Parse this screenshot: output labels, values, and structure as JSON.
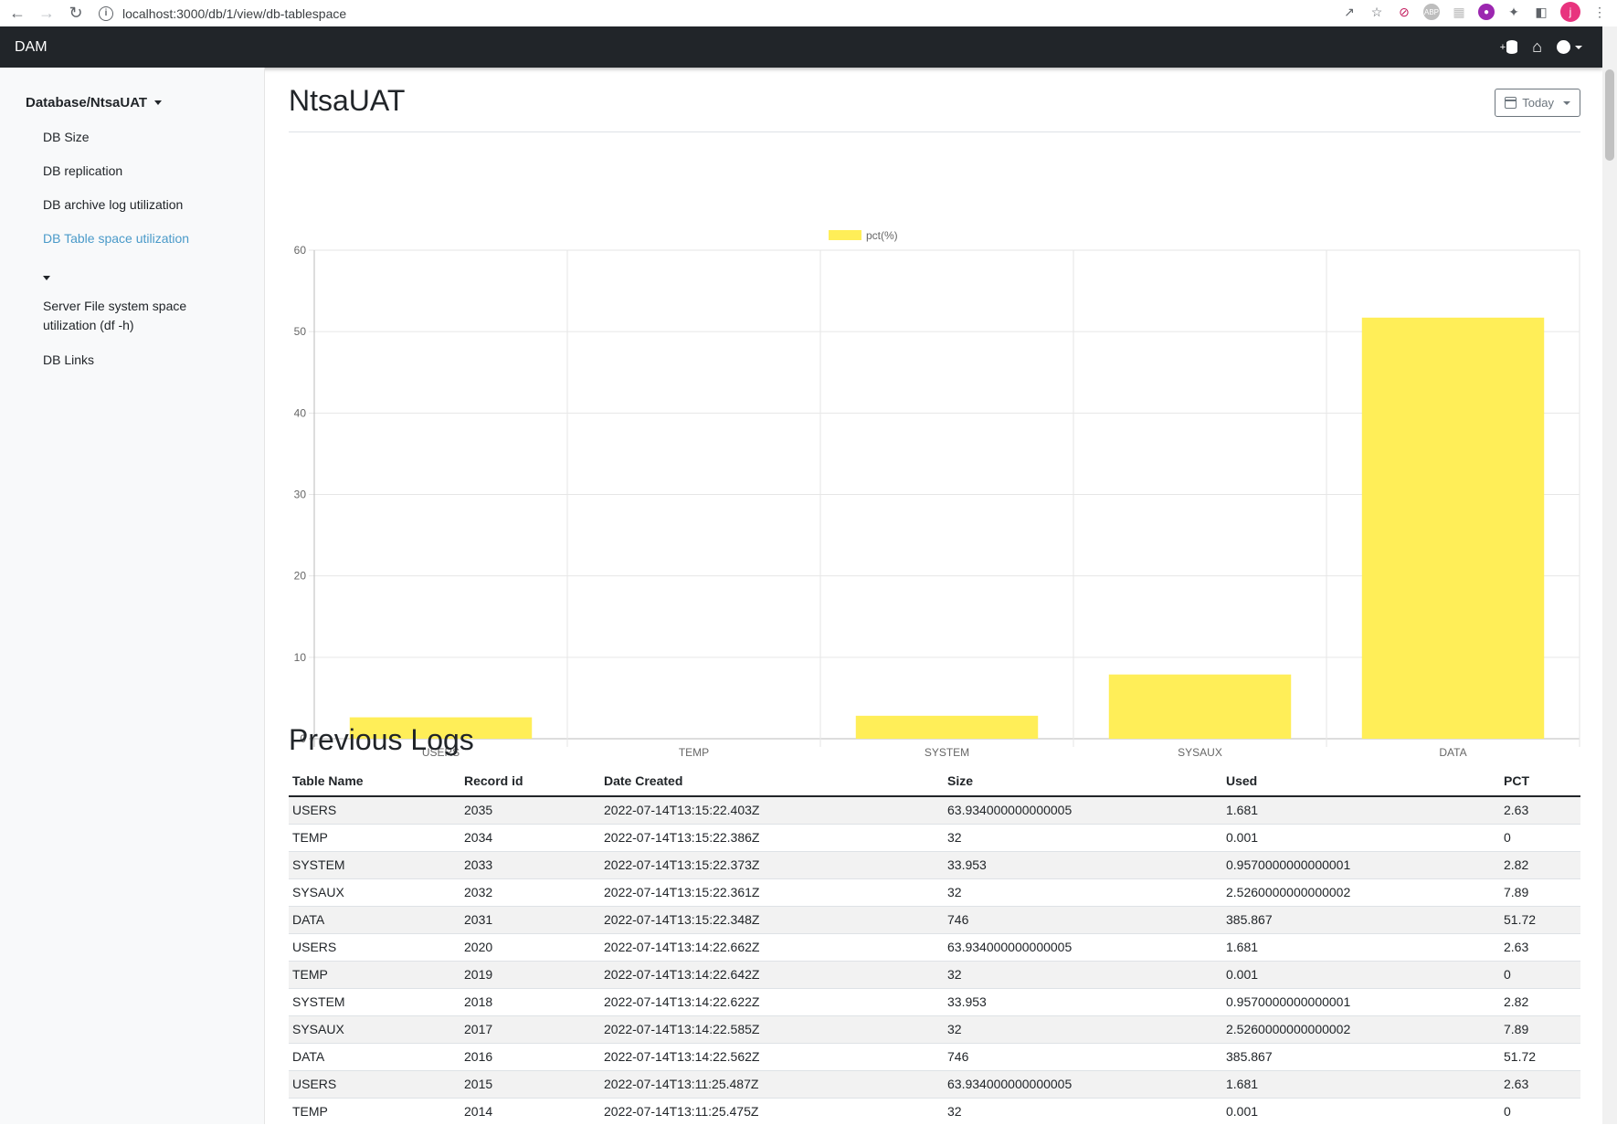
{
  "browser": {
    "url": "localhost:3000/db/1/view/db-tablespace",
    "profile_initial": "j"
  },
  "navbar": {
    "brand": "DAM",
    "add_db_plus": "+"
  },
  "sidebar": {
    "heading": "Database/NtsaUAT",
    "items": [
      {
        "label": "DB Size"
      },
      {
        "label": "DB replication"
      },
      {
        "label": "DB archive log utilization"
      },
      {
        "label": "DB Table space utilization"
      },
      {
        "label": "Server File system space utilization (df -h)"
      },
      {
        "label": "DB Links"
      }
    ]
  },
  "main": {
    "title": "NtsaUAT",
    "date_filter": "Today",
    "logs_title": "Previous Logs"
  },
  "chart_data": {
    "type": "bar",
    "categories": [
      "USERS",
      "TEMP",
      "SYSTEM",
      "SYSAUX",
      "DATA"
    ],
    "series": [
      {
        "name": "pct(%)",
        "values": [
          2.63,
          0,
          2.82,
          7.89,
          51.72
        ],
        "color": "#ffee58"
      }
    ],
    "ylim": [
      0,
      60
    ],
    "yticks": [
      0,
      10,
      20,
      30,
      40,
      50,
      60
    ],
    "grid": true,
    "legend": "top-center"
  },
  "table": {
    "columns": [
      "Table Name",
      "Record id",
      "Date Created",
      "Size",
      "Used",
      "PCT"
    ],
    "rows": [
      [
        "USERS",
        "2035",
        "2022-07-14T13:15:22.403Z",
        "63.934000000000005",
        "1.681",
        "2.63"
      ],
      [
        "TEMP",
        "2034",
        "2022-07-14T13:15:22.386Z",
        "32",
        "0.001",
        "0"
      ],
      [
        "SYSTEM",
        "2033",
        "2022-07-14T13:15:22.373Z",
        "33.953",
        "0.9570000000000001",
        "2.82"
      ],
      [
        "SYSAUX",
        "2032",
        "2022-07-14T13:15:22.361Z",
        "32",
        "2.5260000000000002",
        "7.89"
      ],
      [
        "DATA",
        "2031",
        "2022-07-14T13:15:22.348Z",
        "746",
        "385.867",
        "51.72"
      ],
      [
        "USERS",
        "2020",
        "2022-07-14T13:14:22.662Z",
        "63.934000000000005",
        "1.681",
        "2.63"
      ],
      [
        "TEMP",
        "2019",
        "2022-07-14T13:14:22.642Z",
        "32",
        "0.001",
        "0"
      ],
      [
        "SYSTEM",
        "2018",
        "2022-07-14T13:14:22.622Z",
        "33.953",
        "0.9570000000000001",
        "2.82"
      ],
      [
        "SYSAUX",
        "2017",
        "2022-07-14T13:14:22.585Z",
        "32",
        "2.5260000000000002",
        "7.89"
      ],
      [
        "DATA",
        "2016",
        "2022-07-14T13:14:22.562Z",
        "746",
        "385.867",
        "51.72"
      ],
      [
        "USERS",
        "2015",
        "2022-07-14T13:11:25.487Z",
        "63.934000000000005",
        "1.681",
        "2.63"
      ],
      [
        "TEMP",
        "2014",
        "2022-07-14T13:11:25.475Z",
        "32",
        "0.001",
        "0"
      ]
    ]
  }
}
